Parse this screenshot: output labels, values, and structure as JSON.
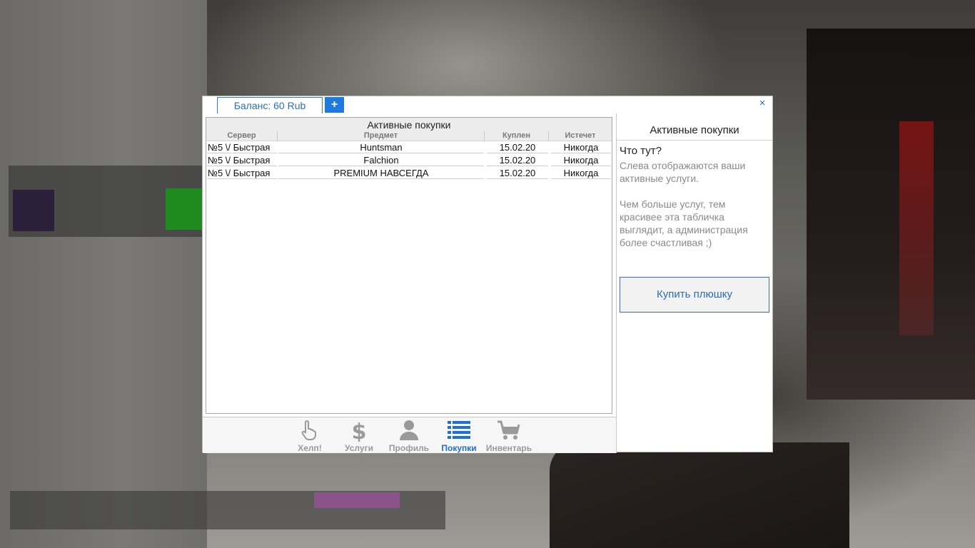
{
  "tabs": {
    "balance_label": "Баланс: 60 Rub",
    "plus_label": "+"
  },
  "close_label": "×",
  "purchases": {
    "title": "Активные покупки",
    "columns": [
      "Сервер",
      "Предмет",
      "Куплен",
      "Истечет"
    ],
    "rows": [
      {
        "server": "№5 \\/ Быстрая",
        "item": "Huntsman",
        "bought": "15.02.20",
        "expires": "Никогда"
      },
      {
        "server": "№5 \\/ Быстрая",
        "item": "Falchion",
        "bought": "15.02.20",
        "expires": "Никогда"
      },
      {
        "server": "№5 \\/ Быстрая",
        "item": "PREMIUM НАВСЕГДА",
        "bought": "15.02.20",
        "expires": "Никогда"
      }
    ]
  },
  "nav": {
    "items": [
      {
        "label": "Хелп!",
        "icon": "pointing-hand-icon",
        "active": false
      },
      {
        "label": "Услуги",
        "icon": "dollar-icon",
        "active": false
      },
      {
        "label": "Профиль",
        "icon": "user-icon",
        "active": false
      },
      {
        "label": "Покупки",
        "icon": "list-icon",
        "active": true
      },
      {
        "label": "Инвентарь",
        "icon": "cart-add-icon",
        "active": false
      }
    ],
    "active_color": "#1f6fd6",
    "inactive_color": "#9a9a9a"
  },
  "sidebar": {
    "title": "Активные покупки",
    "question": "Что тут?",
    "paragraph1": "Слева отображаются ваши активные услуги.",
    "paragraph2": "Чем больше услуг, тем красивее эта табличка выглядит, а администрация более счастливая ;)",
    "buy_button": "Купить плюшку"
  },
  "colors": {
    "accent": "#1f7ae0",
    "link": "#2a6ebd"
  }
}
